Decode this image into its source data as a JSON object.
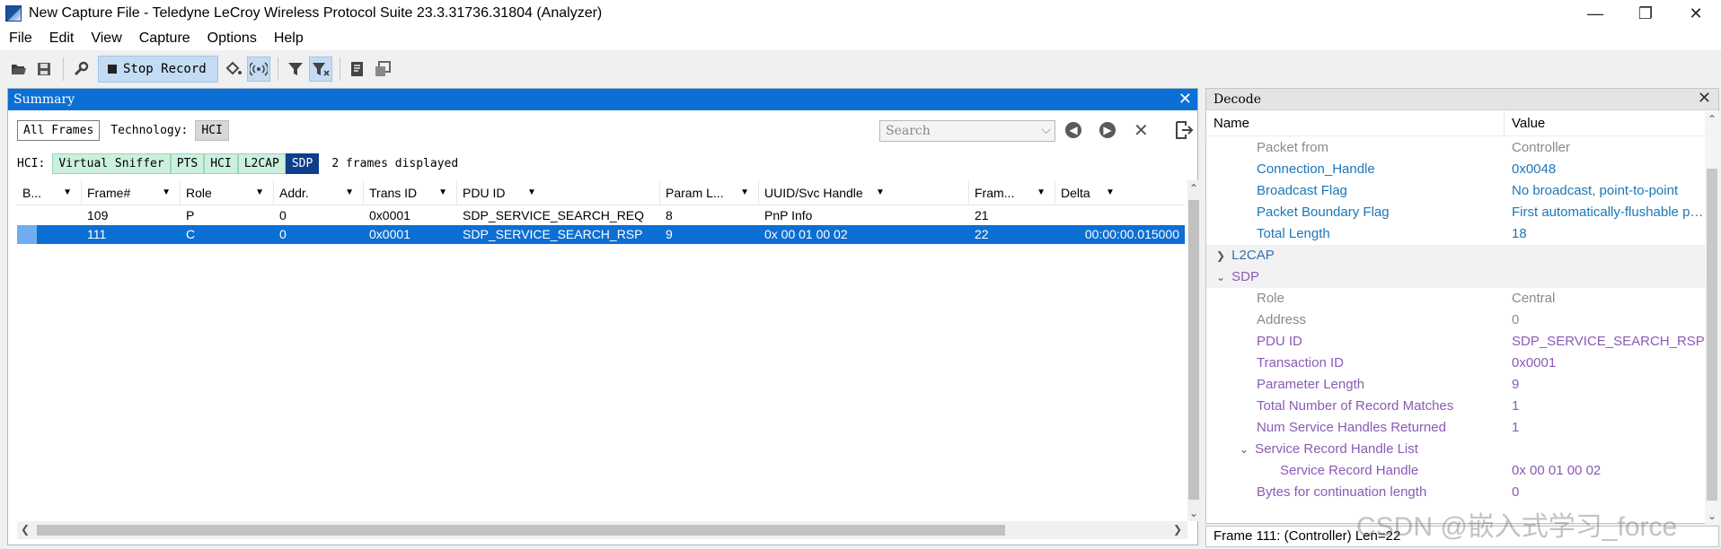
{
  "window": {
    "title": "New Capture File - Teledyne LeCroy Wireless Protocol Suite 23.3.31736.31804  (Analyzer)",
    "minimize": "—",
    "maximize": "❐",
    "close": "✕"
  },
  "menu": [
    "File",
    "Edit",
    "View",
    "Capture",
    "Options",
    "Help"
  ],
  "toolbar": {
    "record_label": "Stop Record"
  },
  "summary": {
    "title": "Summary",
    "all_frames": "All Frames",
    "technology_label": "Technology:",
    "technology_value": "HCI",
    "search_placeholder": "Search",
    "filter_label": "HCI:",
    "filters": [
      "Virtual Sniffer",
      "PTS",
      "HCI",
      "L2CAP",
      "SDP"
    ],
    "frames_displayed": "2 frames displayed",
    "columns": [
      "B...",
      "Frame#",
      "Role",
      "Addr.",
      "Trans ID",
      "PDU ID",
      "Param L...",
      "UUID/Svc Handle",
      "Fram...",
      "Delta"
    ],
    "rows": [
      [
        "",
        "109",
        "P",
        "0",
        "0x0001",
        "SDP_SERVICE_SEARCH_REQ",
        "8",
        "PnP Info",
        "21",
        ""
      ],
      [
        "",
        "111",
        "C",
        "0",
        "0x0001",
        "SDP_SERVICE_SEARCH_RSP",
        "9",
        "0x 00 01 00 02",
        "22",
        "00:00:00.015000"
      ]
    ]
  },
  "decode": {
    "title": "Decode",
    "col_name": "Name",
    "col_value": "Value",
    "rows": [
      {
        "name": "Packet from",
        "value": "Controller"
      },
      {
        "name": "Connection_Handle",
        "value": "0x0048"
      },
      {
        "name": "Broadcast Flag",
        "value": "No broadcast, point-to-point"
      },
      {
        "name": "Packet Boundary Flag",
        "value": "First automatically-flushable packet"
      },
      {
        "name": "Total Length",
        "value": "18"
      },
      {
        "name": "L2CAP",
        "value": ""
      },
      {
        "name": "SDP",
        "value": ""
      },
      {
        "name": "Role",
        "value": "Central"
      },
      {
        "name": "Address",
        "value": "0"
      },
      {
        "name": "PDU ID",
        "value": "SDP_SERVICE_SEARCH_RSP"
      },
      {
        "name": "Transaction ID",
        "value": "0x0001"
      },
      {
        "name": "Parameter Length",
        "value": "9"
      },
      {
        "name": "Total Number of Record Matches",
        "value": "1"
      },
      {
        "name": "Num Service Handles Returned",
        "value": "1"
      },
      {
        "name": "Service Record Handle List",
        "value": ""
      },
      {
        "name": "Service Record Handle",
        "value": "0x 00 01 00 02"
      },
      {
        "name": "Bytes for continuation length",
        "value": "0"
      }
    ],
    "status": "Frame 111: (Controller) Len=22"
  },
  "watermark": "CSDN @嵌入式学习_force"
}
